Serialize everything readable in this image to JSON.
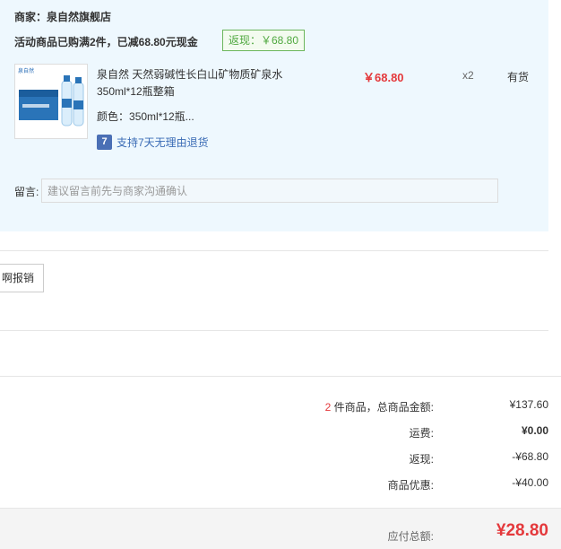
{
  "merchant": {
    "label": "商家：",
    "name": "泉自然旗舰店"
  },
  "promo": {
    "text": "活动商品已购满2件，已减68.80元现金",
    "rebate_badge": "返现：￥68.80"
  },
  "product": {
    "title": "泉自然 天然弱碱性长白山矿物质矿泉水350ml*12瓶整箱",
    "color_label": "颜色：",
    "color_value": "350ml*12瓶...",
    "return_icon": "7",
    "return_text": "支持7天无理由退货",
    "price": "￥68.80",
    "qty": "x2",
    "stock": "有货",
    "thumb_brand": "泉自然"
  },
  "memo": {
    "label": "留言:",
    "placeholder": "建议留言前先与商家沟通确认"
  },
  "invoice": {
    "button_label": "啊报销"
  },
  "summary": {
    "count": "2",
    "count_label": " 件商品，总商品金额:",
    "subtotal": "¥137.60",
    "shipping_label": "运费:",
    "shipping": "¥0.00",
    "rebate_label": "返现:",
    "rebate": "-¥68.80",
    "discount_label": "商品优惠:",
    "discount": "-¥40.00",
    "total_label": "应付总额:",
    "total": "¥28.80"
  },
  "colors": {
    "accent_red": "#e4393c",
    "badge_green": "#4fa83f",
    "link_blue": "#3a6bb5",
    "panel_bg": "#eef8fe"
  },
  "icons": [
    "product-thumbnail",
    "seven-day-return-icon"
  ]
}
